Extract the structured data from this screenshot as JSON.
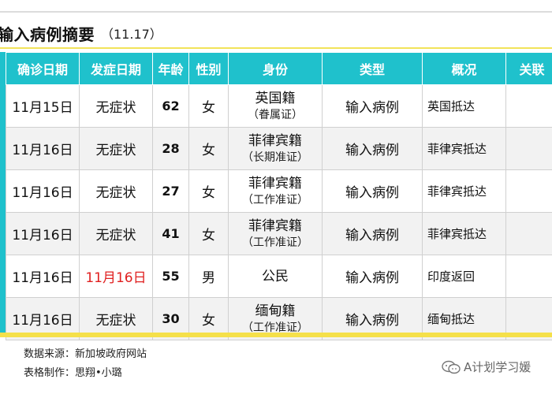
{
  "title": {
    "main": "输入病例摘要",
    "date": "（11.17）"
  },
  "table": {
    "headers": [
      "确诊日期",
      "发症日期",
      "年龄",
      "性别",
      "身份",
      "类型",
      "概况",
      "关联"
    ],
    "rows": [
      {
        "confirm_date": "11月15日",
        "onset_date": "无症状",
        "age": "62",
        "gender": "女",
        "identity": "英国籍",
        "identity_note": "（眷属证）",
        "type": "输入病例",
        "summary": "英国抵达",
        "link": ""
      },
      {
        "confirm_date": "11月16日",
        "onset_date": "无症状",
        "age": "28",
        "gender": "女",
        "identity": "菲律宾籍",
        "identity_note": "（长期准证）",
        "type": "输入病例",
        "summary": "菲律宾抵达",
        "link": ""
      },
      {
        "confirm_date": "11月16日",
        "onset_date": "无症状",
        "age": "27",
        "gender": "女",
        "identity": "菲律宾籍",
        "identity_note": "（工作准证）",
        "type": "输入病例",
        "summary": "菲律宾抵达",
        "link": ""
      },
      {
        "confirm_date": "11月16日",
        "onset_date": "无症状",
        "age": "41",
        "gender": "女",
        "identity": "菲律宾籍",
        "identity_note": "（工作准证）",
        "type": "输入病例",
        "summary": "菲律宾抵达",
        "link": ""
      },
      {
        "confirm_date": "11月16日",
        "onset_date": "11月16日",
        "age": "55",
        "gender": "男",
        "identity": "公民",
        "identity_note": "",
        "type": "输入病例",
        "summary": "印度返回",
        "link": ""
      },
      {
        "confirm_date": "11月16日",
        "onset_date": "无症状",
        "age": "30",
        "gender": "女",
        "identity": "缅甸籍",
        "identity_note": "（工作准证）",
        "type": "输入病例",
        "summary": "缅甸抵达",
        "link": ""
      }
    ]
  },
  "footer": {
    "source": "数据来源：新加坡政府网站",
    "maker": "表格制作：思翔•小璐"
  },
  "watermark": {
    "text": "A计划学习媛",
    "icon": "wechat-icon"
  },
  "colors": {
    "header_bg": "#1fc1cc",
    "accent_yellow": "#f5e04a",
    "highlight_red": "#e02020"
  }
}
